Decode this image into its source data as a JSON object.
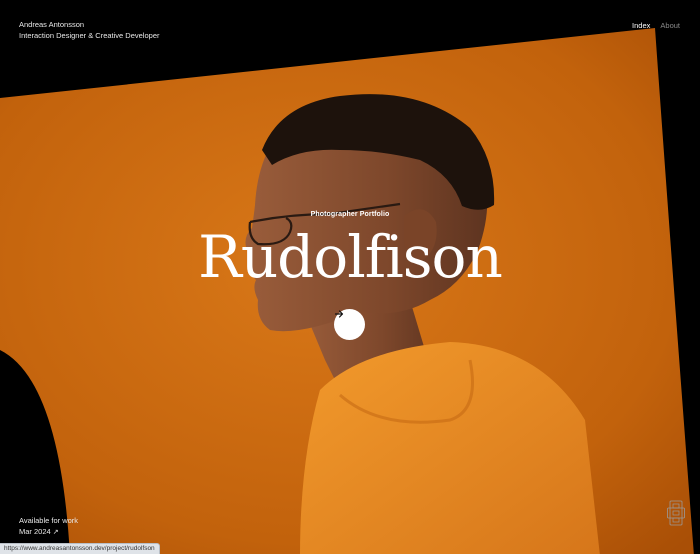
{
  "header": {
    "name": "Andreas Antonsson",
    "role": "Interaction Designer & Creative Developer",
    "nav": [
      {
        "label": "Index",
        "active": true
      },
      {
        "label": "About",
        "active": false
      }
    ]
  },
  "project": {
    "eyebrow": "Photographer Portfolio",
    "title": "Rudolfison",
    "cta_icon": "arrow-right-icon"
  },
  "footer": {
    "availability": "Available for work",
    "date": "Mar 2024",
    "date_icon": "arrow-up-right-icon"
  },
  "status_bar": {
    "url": "https://www.andreasantonsson.dev/project/rudolfson"
  },
  "colors": {
    "background": "#000000",
    "hero_orange": "#c86a10",
    "shirt": "#e88a1e",
    "skin": "#8a5234",
    "hair": "#1d120c"
  }
}
